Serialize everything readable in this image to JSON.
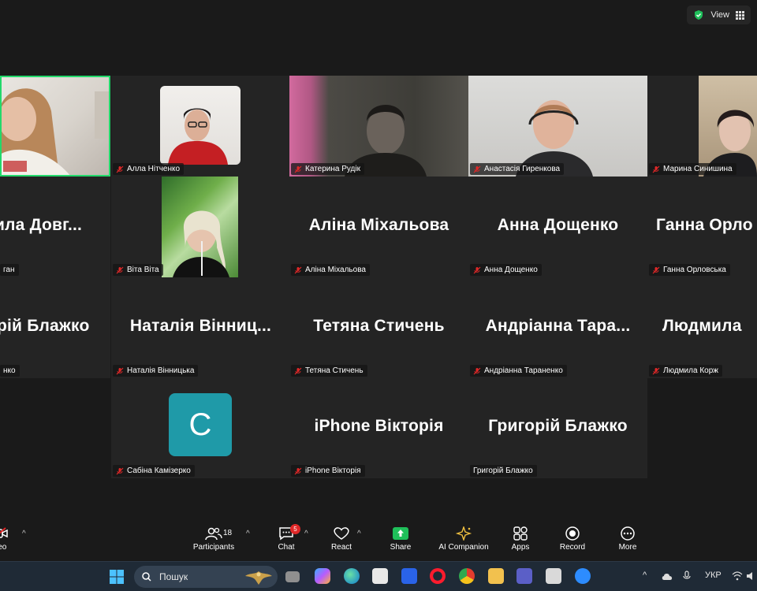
{
  "topbar": {
    "view_label": "View"
  },
  "tiles": [
    {
      "label": "",
      "big_name": ""
    },
    {
      "label": "Алла Нітченко"
    },
    {
      "label": "Катерина Рудік"
    },
    {
      "label": "Анастасія Гиренкова"
    },
    {
      "label": "Марина Синишина"
    },
    {
      "label": "ган",
      "big_name": "ила Довг..."
    },
    {
      "label": "Віта Віта"
    },
    {
      "label": "Аліна Міхальова",
      "big_name": "Аліна Міхальова"
    },
    {
      "label": "Анна Дощенко",
      "big_name": "Анна Дощенко"
    },
    {
      "label": "Ганна Орловська",
      "big_name": "Ганна Орло"
    },
    {
      "label": "нко",
      "big_name": "рій Блажко"
    },
    {
      "label": "Наталія Вінницька",
      "big_name": "Наталія Вінниц..."
    },
    {
      "label": "Тетяна Стичень",
      "big_name": "Тетяна Стичень"
    },
    {
      "label": "Андріанна Тараненко",
      "big_name": "Андріанна Тара..."
    },
    {
      "label": "Людмила Корж",
      "big_name": "Людмила"
    },
    {
      "label": "Сабіна Камізерко",
      "avatar_letter": "C"
    },
    {
      "label": "iPhone Вікторія",
      "big_name": "iPhone Вікторія"
    },
    {
      "label": "Григорій Блажко",
      "big_name": "Григорій Блажко"
    }
  ],
  "toolbar": {
    "video_label": "deo",
    "participants_label": "Participants",
    "participants_count": "18",
    "chat_label": "Chat",
    "chat_badge": "5",
    "react_label": "React",
    "share_label": "Share",
    "ai_label": "AI Companion",
    "apps_label": "Apps",
    "record_label": "Record",
    "more_label": "More",
    "caret": "^"
  },
  "taskbar": {
    "search_placeholder": "Пошук",
    "language": "УКР"
  },
  "colors": {
    "active_speaker": "#23d96b",
    "muted": "#e02828",
    "avatar": "#1f9aa8",
    "share": "#1fbf5a"
  }
}
